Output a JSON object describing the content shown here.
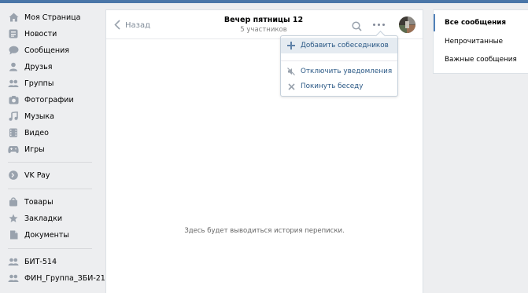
{
  "colors": {
    "accent": "#4a76a8",
    "link": "#2a5885",
    "icon": "#99a2ad",
    "background": "#edeef0"
  },
  "sidebar": {
    "items": [
      {
        "label": "Моя Страница",
        "icon": "home-icon"
      },
      {
        "label": "Новости",
        "icon": "news-icon"
      },
      {
        "label": "Сообщения",
        "icon": "messages-icon"
      },
      {
        "label": "Друзья",
        "icon": "friend-icon"
      },
      {
        "label": "Группы",
        "icon": "groups-icon"
      },
      {
        "label": "Фотографии",
        "icon": "camera-icon"
      },
      {
        "label": "Музыка",
        "icon": "music-note-icon"
      },
      {
        "label": "Видео",
        "icon": "film-icon"
      },
      {
        "label": "Игры",
        "icon": "gamepad-icon"
      },
      {
        "label": "VK Pay",
        "icon": "vkpay-icon"
      },
      {
        "label": "Товары",
        "icon": "shopping-bag-icon"
      },
      {
        "label": "Закладки",
        "icon": "star-icon"
      },
      {
        "label": "Документы",
        "icon": "document-icon"
      },
      {
        "label": "БИТ-514",
        "icon": "group-chat-icon"
      },
      {
        "label": "ФИН_Группа_ЗБИ-21",
        "icon": "group-chat-icon"
      }
    ]
  },
  "chat": {
    "back_label": "Назад",
    "title": "Вечер пятницы 12",
    "subtitle": "5 участников",
    "empty_text": "Здесь будет выводиться история переписки."
  },
  "menu": {
    "items": [
      {
        "label": "Добавить собеседников",
        "icon": "plus-icon"
      },
      {
        "label": "Отключить уведомления",
        "icon": "mute-icon"
      },
      {
        "label": "Покинуть беседу",
        "icon": "close-icon"
      }
    ]
  },
  "filters": {
    "items": [
      {
        "label": "Все сообщения",
        "active": true
      },
      {
        "label": "Непрочитанные",
        "active": false
      },
      {
        "label": "Важные сообщения",
        "active": false
      }
    ]
  }
}
